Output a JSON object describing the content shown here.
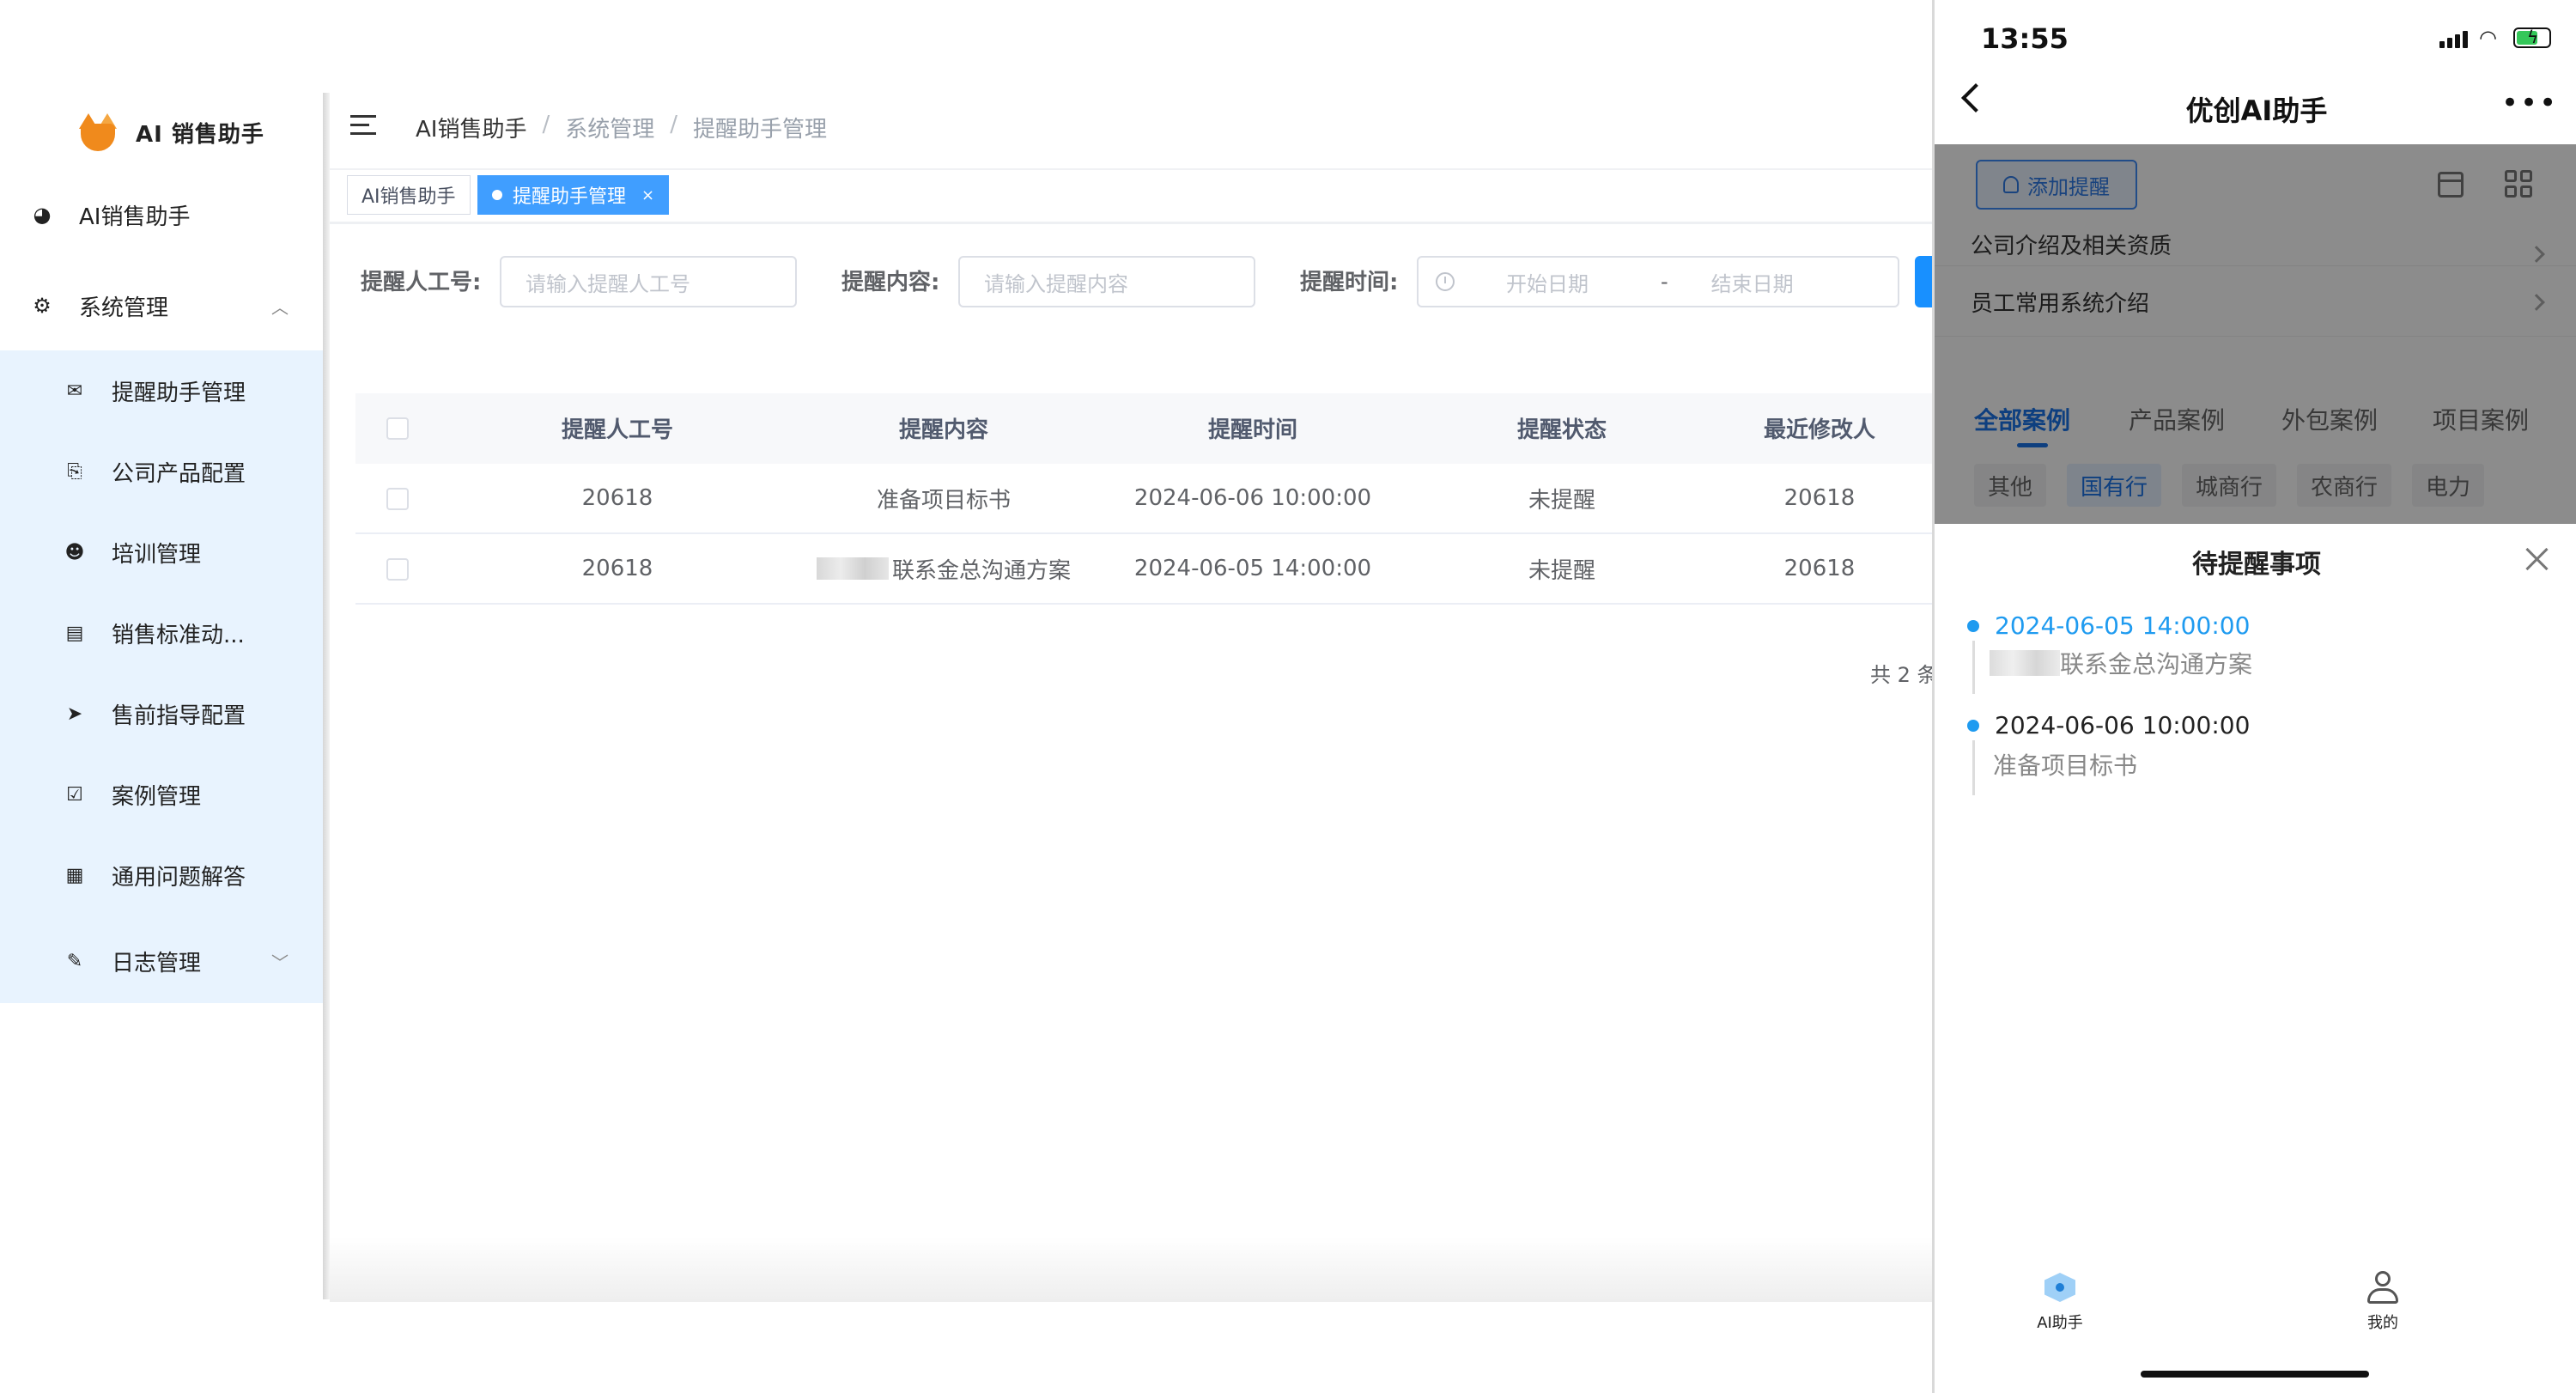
{
  "sidebar": {
    "logo_text": "AI 销售助手",
    "top_items": [
      {
        "label": "AI销售助手",
        "icon": "dashboard-icon"
      },
      {
        "label": "系统管理",
        "icon": "gear-icon"
      }
    ],
    "sub_items": [
      {
        "label": "提醒助手管理",
        "icon": "envelope-icon"
      },
      {
        "label": "公司产品配置",
        "icon": "document-settings-icon"
      },
      {
        "label": "培训管理",
        "icon": "robot-icon"
      },
      {
        "label": "销售标准动...",
        "icon": "file-text-icon"
      },
      {
        "label": "售前指导配置",
        "icon": "paper-plane-icon"
      },
      {
        "label": "案例管理",
        "icon": "checkbox-icon"
      },
      {
        "label": "通用问题解答",
        "icon": "table-icon"
      },
      {
        "label": "日志管理",
        "icon": "edit-icon"
      }
    ]
  },
  "header": {
    "breadcrumb": [
      "AI销售助手",
      "系统管理",
      "提醒助手管理"
    ]
  },
  "tabs": [
    {
      "label": "AI销售助手",
      "active": false
    },
    {
      "label": "提醒助手管理",
      "active": true,
      "close": "×"
    }
  ],
  "filters": {
    "worker_label": "提醒人工号:",
    "worker_placeholder": "请输入提醒人工号",
    "content_label": "提醒内容:",
    "content_placeholder": "请输入提醒内容",
    "time_label": "提醒时间:",
    "start_placeholder": "开始日期",
    "range_sep": "-",
    "end_placeholder": "结束日期"
  },
  "table": {
    "columns": [
      "提醒人工号",
      "提醒内容",
      "提醒时间",
      "提醒状态",
      "最近修改人"
    ],
    "rows": [
      {
        "worker": "20618",
        "content": "准备项目标书",
        "time": "2024-06-06 10:00:00",
        "status": "未提醒",
        "modifier": "20618",
        "blurred": false
      },
      {
        "worker": "20618",
        "content": "联系金总沟通方案",
        "time": "2024-06-05 14:00:00",
        "status": "未提醒",
        "modifier": "20618",
        "blurred": true
      }
    ],
    "total_text": "共 2 条"
  },
  "phone": {
    "status_time": "13:55",
    "nav_title": "优创AI助手",
    "nav_more": "•••",
    "add_reminder": "添加提醒",
    "list_rows": [
      "公司介绍及相关资质",
      "员工常用系统介绍"
    ],
    "case_tabs": [
      "全部案例",
      "产品案例",
      "外包案例",
      "项目案例"
    ],
    "chips": [
      "其他",
      "国有行",
      "城商行",
      "农商行",
      "电力"
    ],
    "popup_title": "待提醒事项",
    "reminders": [
      {
        "time": "2024-06-05 14:00:00",
        "content": "联系金总沟通方案",
        "blurred": true
      },
      {
        "time": "2024-06-06 10:00:00",
        "content": "准备项目标书",
        "blurred": false
      }
    ],
    "tabbar": [
      {
        "label": "AI助手",
        "icon": "home-hex-icon"
      },
      {
        "label": "我的",
        "icon": "user-icon"
      }
    ]
  },
  "colors": {
    "primary": "#409eff",
    "submenu_bg": "#e8f3fe",
    "logo_orange": "#f08a1c"
  }
}
